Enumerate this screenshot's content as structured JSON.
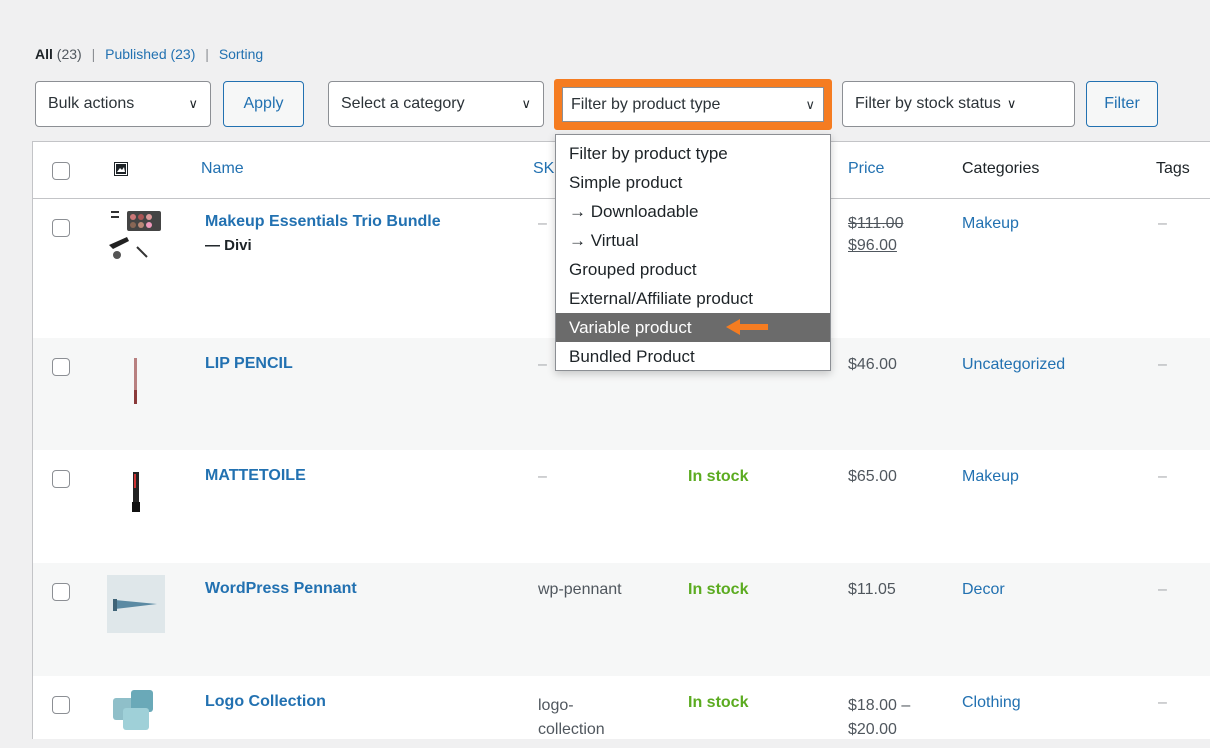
{
  "views": {
    "all": "All",
    "all_count": "(23)",
    "published": "Published (23)",
    "sorting": "Sorting",
    "sep": "|"
  },
  "toolbar": {
    "bulk_actions": "Bulk actions",
    "apply": "Apply",
    "category": "Select a category",
    "product_type": "Filter by product type",
    "stock_status": "Filter by stock status",
    "filter": "Filter",
    "chevron": "∨"
  },
  "columns": {
    "name": "Name",
    "sku": "SKU",
    "price": "Price",
    "categories": "Categories",
    "tags": "Tags",
    "image_icon": "image-icon"
  },
  "rows": [
    {
      "name": "Makeup Essentials Trio Bundle",
      "sub": "— Divi",
      "sku": "–",
      "stock": "",
      "price_old": "$111.00",
      "price_new": "$96.00",
      "category": "Makeup",
      "tags": "–"
    },
    {
      "name": "LIP PENCIL",
      "sku": "–",
      "stock": "",
      "price": "$46.00",
      "category": "Uncategorized",
      "tags": "–"
    },
    {
      "name": "MATTETOILE",
      "sku": "–",
      "stock": "In stock",
      "price": "$65.00",
      "category": "Makeup",
      "tags": "–"
    },
    {
      "name": "WordPress Pennant",
      "sku": "wp-pennant",
      "stock": "In stock",
      "price": "$11.05",
      "category": "Decor",
      "tags": "–"
    },
    {
      "name": "Logo Collection",
      "sku_line1": "logo-",
      "sku_line2": "collection",
      "stock": "In stock",
      "price_line1": "$18.00 –",
      "price_line2": "$20.00",
      "category": "Clothing",
      "tags": "–"
    }
  ],
  "dropdown": {
    "options": [
      "Filter by product type",
      "Simple product",
      "→ Downloadable",
      "→ Virtual",
      "Grouped product",
      "External/Affiliate product",
      "Variable product",
      "Bundled Product"
    ],
    "selected_index": 6
  },
  "colors": {
    "accent": "#2271b1",
    "highlight": "#f57c21",
    "in_stock": "#5bab20"
  }
}
